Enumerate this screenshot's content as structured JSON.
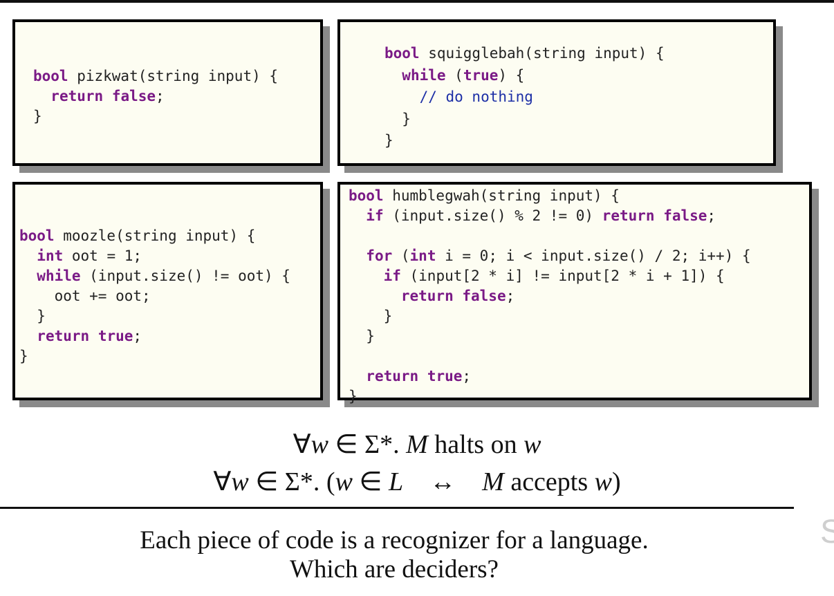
{
  "slide": {
    "boxes": [
      {
        "id": "pizkwat",
        "lines": [
          [
            {
              "t": "bool",
              "c": "kw"
            },
            {
              "t": " pizkwat(string input) {"
            }
          ],
          [
            {
              "t": "  "
            },
            {
              "t": "return",
              "c": "kw"
            },
            {
              "t": " "
            },
            {
              "t": "false",
              "c": "kw"
            },
            {
              "t": ";"
            }
          ],
          [
            {
              "t": "}"
            }
          ]
        ]
      },
      {
        "id": "squigglebah",
        "lines": [
          [
            {
              "t": "bool",
              "c": "kw"
            },
            {
              "t": " squigglebah(string input) {"
            }
          ],
          [
            {
              "t": "  "
            },
            {
              "t": "while",
              "c": "kw"
            },
            {
              "t": " ("
            },
            {
              "t": "true",
              "c": "kw"
            },
            {
              "t": ") {"
            }
          ],
          [
            {
              "t": "    "
            },
            {
              "t": "// do nothing",
              "c": "cm"
            }
          ],
          [
            {
              "t": "  }"
            }
          ],
          [
            {
              "t": "}"
            }
          ]
        ]
      },
      {
        "id": "moozle",
        "lines": [
          [
            {
              "t": "bool",
              "c": "kw"
            },
            {
              "t": " moozle(string input) {"
            }
          ],
          [
            {
              "t": "  "
            },
            {
              "t": "int",
              "c": "kw"
            },
            {
              "t": " oot = 1;"
            }
          ],
          [
            {
              "t": "  "
            },
            {
              "t": "while",
              "c": "kw"
            },
            {
              "t": " (input.size() != oot) {"
            }
          ],
          [
            {
              "t": "    oot += oot;"
            }
          ],
          [
            {
              "t": "  }"
            }
          ],
          [
            {
              "t": "  "
            },
            {
              "t": "return",
              "c": "kw"
            },
            {
              "t": " "
            },
            {
              "t": "true",
              "c": "kw"
            },
            {
              "t": ";"
            }
          ],
          [
            {
              "t": "}"
            }
          ]
        ]
      },
      {
        "id": "humblegwah",
        "lines": [
          [
            {
              "t": "bool",
              "c": "kw"
            },
            {
              "t": " humblegwah(string input) {"
            }
          ],
          [
            {
              "t": "  "
            },
            {
              "t": "if",
              "c": "kw"
            },
            {
              "t": " (input.size() % 2 != 0) "
            },
            {
              "t": "return",
              "c": "kw"
            },
            {
              "t": " "
            },
            {
              "t": "false",
              "c": "kw"
            },
            {
              "t": ";"
            }
          ],
          [
            {
              "t": ""
            }
          ],
          [
            {
              "t": "  "
            },
            {
              "t": "for",
              "c": "kw"
            },
            {
              "t": " ("
            },
            {
              "t": "int",
              "c": "kw"
            },
            {
              "t": " i = 0; i < input.size() / 2; i++) {"
            }
          ],
          [
            {
              "t": "    "
            },
            {
              "t": "if",
              "c": "kw"
            },
            {
              "t": " (input[2 * i] != input[2 * i + 1]) {"
            }
          ],
          [
            {
              "t": "      "
            },
            {
              "t": "return",
              "c": "kw"
            },
            {
              "t": " "
            },
            {
              "t": "false",
              "c": "kw"
            },
            {
              "t": ";"
            }
          ],
          [
            {
              "t": "    }"
            }
          ],
          [
            {
              "t": "  }"
            }
          ],
          [
            {
              "t": ""
            }
          ],
          [
            {
              "t": "  "
            },
            {
              "t": "return",
              "c": "kw"
            },
            {
              "t": " "
            },
            {
              "t": "true",
              "c": "kw"
            },
            {
              "t": ";"
            }
          ],
          [
            {
              "t": "}"
            }
          ]
        ]
      }
    ],
    "math": [
      [
        {
          "t": "∀"
        },
        {
          "t": "w",
          "i": true
        },
        {
          "t": " ∈ Σ*. "
        },
        {
          "t": "M",
          "i": true
        },
        {
          "t": " halts on "
        },
        {
          "t": "w",
          "i": true
        }
      ],
      [
        {
          "t": "∀"
        },
        {
          "t": "w",
          "i": true
        },
        {
          "t": " ∈ Σ*. ("
        },
        {
          "t": "w",
          "i": true
        },
        {
          "t": " ∈ "
        },
        {
          "t": "L",
          "i": true
        },
        {
          "t": "    ↔    "
        },
        {
          "t": "M",
          "i": true
        },
        {
          "t": " accepts "
        },
        {
          "t": "w",
          "i": true
        },
        {
          "t": ")"
        }
      ]
    ],
    "caption": {
      "line1": "Each piece of code is a recognizer for a language.",
      "line2": "Which are deciders?"
    },
    "edge_letter": "S",
    "colors": {
      "keyword": "#7a1a86",
      "comment": "#1d2fa6",
      "box_bg": "#fdfdf2",
      "shadow": "#8a8a8a"
    }
  }
}
